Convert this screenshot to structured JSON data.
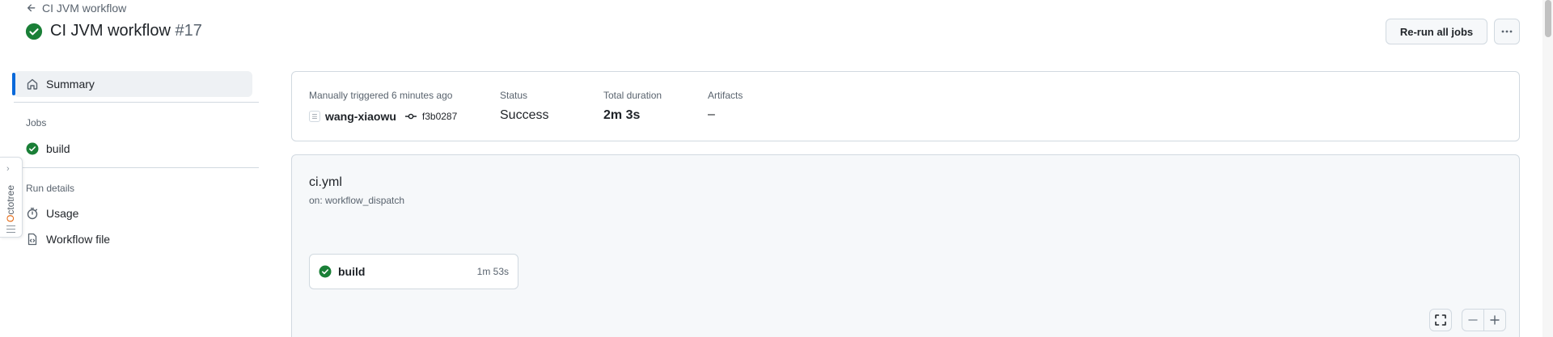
{
  "header": {
    "back_label": "CI JVM workflow",
    "title": "CI JVM workflow",
    "run_number": "#17",
    "rerun_label": "Re-run all jobs",
    "more_label": "···"
  },
  "sidebar": {
    "summary_label": "Summary",
    "jobs_heading": "Jobs",
    "jobs": [
      {
        "label": "build",
        "status": "success"
      }
    ],
    "run_details_heading": "Run details",
    "usage_label": "Usage",
    "workflow_file_label": "Workflow file"
  },
  "octotree": {
    "label_o": "O",
    "label_rest": "ctotree"
  },
  "summary": {
    "trigger_label": "Manually triggered 6 minutes ago",
    "actor": "wang-xiaowu",
    "commit": "f3b0287",
    "status_label": "Status",
    "status_value": "Success",
    "duration_label": "Total duration",
    "duration_value": "2m 3s",
    "artifacts_label": "Artifacts",
    "artifacts_value": "–"
  },
  "workflow": {
    "file_name": "ci.yml",
    "trigger": "on: workflow_dispatch",
    "jobs": [
      {
        "name": "build",
        "duration": "1m 53s",
        "status": "success"
      }
    ]
  },
  "colors": {
    "success": "#1a7f37",
    "accent": "#0969da",
    "border": "#d1d9e0",
    "muted_text": "#59636e"
  },
  "icons": {
    "back": "arrow-left-icon",
    "status": "check-circle-fill-icon",
    "summary": "home-icon",
    "usage": "stopwatch-icon",
    "workflow_file": "file-code-icon",
    "commit": "git-commit-icon",
    "fullscreen": "screen-full-icon",
    "zoom_out": "dash-icon",
    "zoom_in": "plus-icon"
  }
}
